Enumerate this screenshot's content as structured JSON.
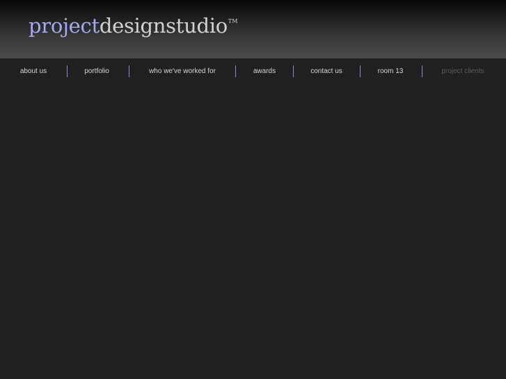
{
  "brand": {
    "part1": "project",
    "part2": "designstudio",
    "trademark": "TM"
  },
  "nav": {
    "about": "about us",
    "portfolio": "portfolio",
    "worked": "who we've worked for",
    "awards": "awards",
    "contact": "contact us",
    "room": "room 13",
    "clients": "project clients"
  },
  "colors": {
    "background": "#202020",
    "brand_accent": "#a9a8ee",
    "separator": "#8c8ad8",
    "nav_text": "#d6d6d6",
    "nav_text_inactive": "#5c5c5c"
  }
}
